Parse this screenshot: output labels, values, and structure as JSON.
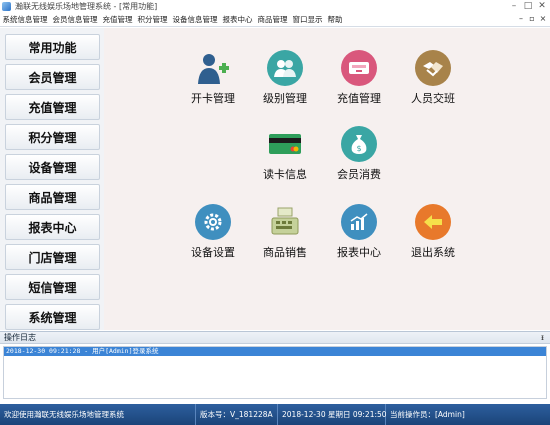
{
  "window": {
    "title": "瀚联无线娱乐场地管理系统 - [常用功能]",
    "controls": [
      "–",
      "□",
      "✕"
    ]
  },
  "menu": {
    "items": [
      "系统信息管理",
      "会员信息管理",
      "充值管理",
      "积分管理",
      "设备信息管理",
      "报表中心",
      "商品管理",
      "窗口显示",
      "帮助"
    ],
    "mdi_controls": [
      "–",
      "▫",
      "×"
    ]
  },
  "sidebar": {
    "items": [
      "常用功能",
      "会员管理",
      "充值管理",
      "积分管理",
      "设备管理",
      "商品管理",
      "报表中心",
      "门店管理",
      "短信管理",
      "系统管理"
    ]
  },
  "tiles": [
    {
      "label": "开卡管理",
      "icon": "open-card-icon",
      "color": "#ffffff"
    },
    {
      "label": "级别管理",
      "icon": "user-level-icon",
      "color": "#3aa6a4"
    },
    {
      "label": "充值管理",
      "icon": "recharge-icon",
      "color": "#d9577c"
    },
    {
      "label": "人员交班",
      "icon": "handshake-icon",
      "color": "#a8834a"
    },
    {
      "label": "读卡信息",
      "icon": "card-reader-icon",
      "color": "#ffffff"
    },
    {
      "label": "会员消费",
      "icon": "money-bag-icon",
      "color": "#3aa6a4"
    },
    {
      "label": "设备设置",
      "icon": "gear-icon",
      "color": "#3f8fbf"
    },
    {
      "label": "商品销售",
      "icon": "cash-register-icon",
      "color": "#ffffff"
    },
    {
      "label": "报表中心",
      "icon": "report-chart-icon",
      "color": "#3f8fbf"
    },
    {
      "label": "退出系统",
      "icon": "exit-arrow-icon",
      "color": "#e8792b"
    }
  ],
  "log": {
    "title": "操作日志",
    "pin": "ᵻ",
    "entries": [
      "2018-12-30 09:21:28 - 用户[Admin]登录系统"
    ]
  },
  "status": {
    "welcome": "欢迎使用瀚联无线娱乐场地管理系统",
    "version": "版本号：V_181228A",
    "datetime": "2018-12-30 星期日 09:21:50",
    "operator": "当前操作员：[Admin]"
  }
}
